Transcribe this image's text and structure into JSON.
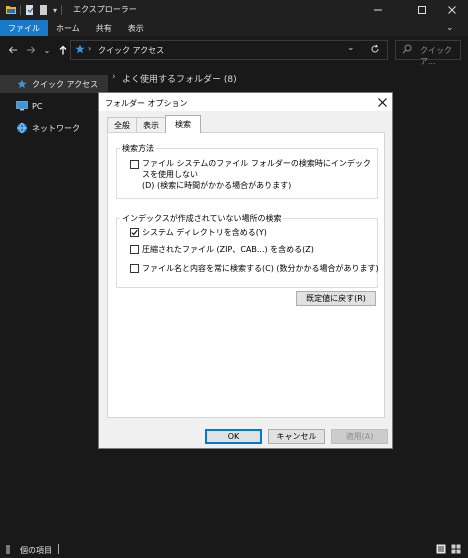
{
  "window": {
    "title": "エクスプローラー"
  },
  "ribbon": {
    "tabs": [
      {
        "label": "ファイル"
      },
      {
        "label": "ホーム"
      },
      {
        "label": "共有"
      },
      {
        "label": "表示"
      }
    ]
  },
  "address": {
    "path": "クイック アクセス"
  },
  "search": {
    "placeholder": "クイック ア..."
  },
  "sidebar": {
    "items": [
      {
        "label": "クイック アクセス",
        "icon": "star-icon",
        "selected": true
      },
      {
        "label": "PC",
        "icon": "pc-icon",
        "selected": false
      },
      {
        "label": "ネットワーク",
        "icon": "network-icon",
        "selected": false
      }
    ]
  },
  "main": {
    "group_header": "よく使用するフォルダー (8)"
  },
  "status": {
    "items_text": "個の項目"
  },
  "dialog": {
    "title": "フォルダー オプション",
    "tabs": [
      {
        "label": "全般",
        "active": false
      },
      {
        "label": "表示",
        "active": false
      },
      {
        "label": "検索",
        "active": true
      }
    ],
    "group_search_method": {
      "label": "検索方法",
      "option": {
        "line1": "ファイル システムのファイル フォルダーの検索時にインデックスを使用しない",
        "line2": "(D) (検索に時間がかかる場合があります)",
        "checked": false
      }
    },
    "group_nonindexed": {
      "label": "インデックスが作成されていない場所の検索",
      "options": [
        {
          "label": "システム ディレクトリを含める(Y)",
          "checked": true
        },
        {
          "label": "圧縮されたファイル (ZIP、CAB...) を含める(Z)",
          "checked": false
        },
        {
          "label": "ファイル名と内容を常に検索する(C) (数分かかる場合があります)",
          "checked": false
        }
      ]
    },
    "restore_label": "既定値に戻す(R)",
    "ok_label": "OK",
    "cancel_label": "キャンセル",
    "apply_label": "適用(A)"
  },
  "colors": {
    "accent": "#1979ca",
    "explorer_bg": "#191919",
    "dialog_bg": "#f0f0f0"
  }
}
